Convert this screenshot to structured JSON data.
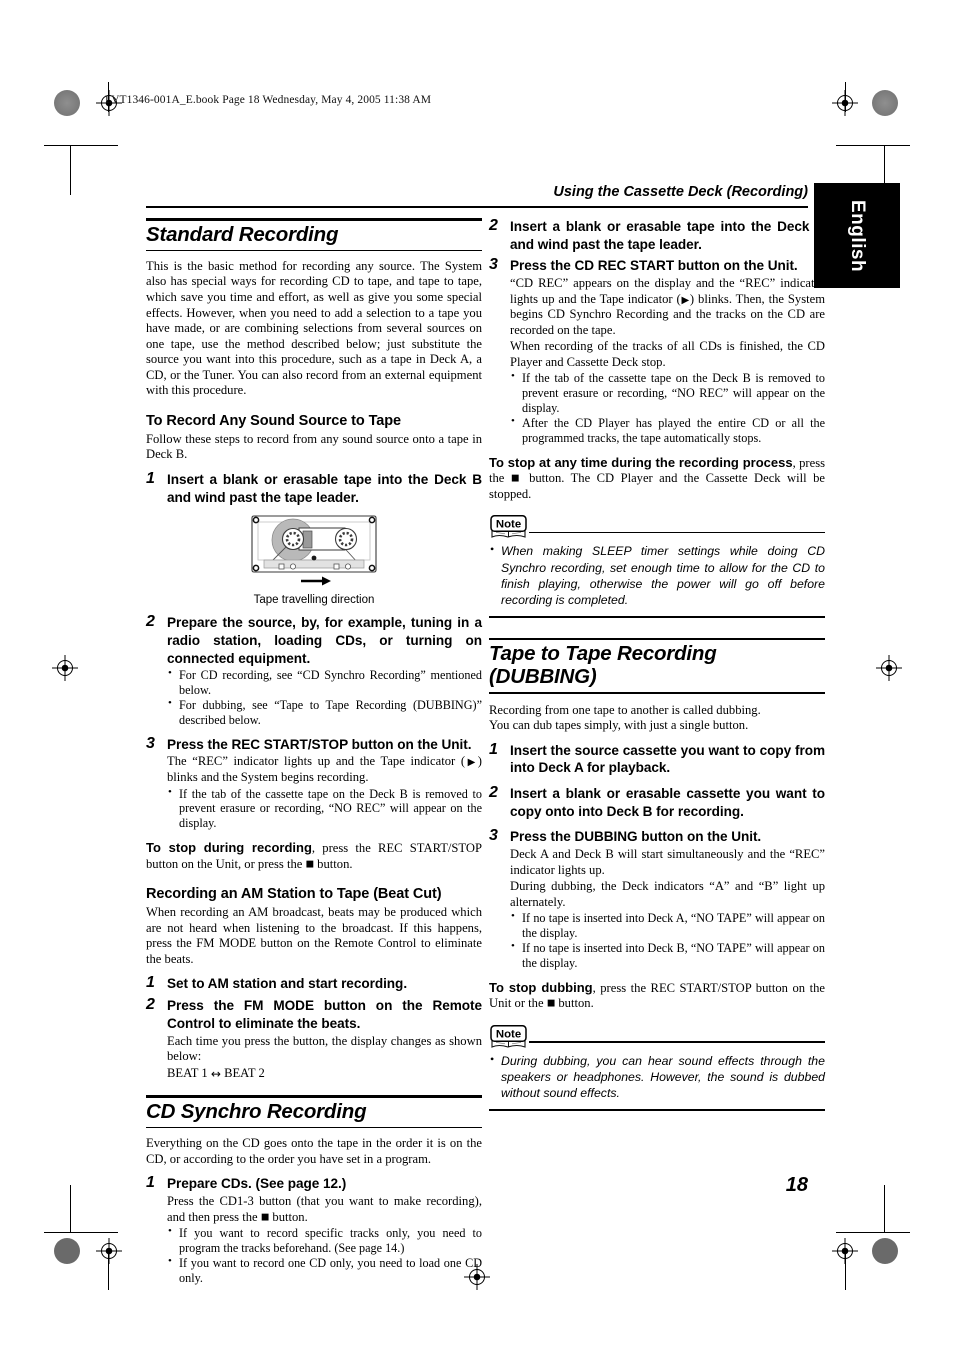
{
  "print_marks": {
    "file_header": "LVT1346-001A_E.book  Page 18  Wednesday, May 4, 2005  11:38 AM"
  },
  "running_head": "Using the Cassette Deck (Recording)",
  "side_tab": "English",
  "page_number": "18",
  "left_column": {
    "section1": {
      "title": "Standard Recording",
      "intro": "This is the basic method for recording any source. The System also has special ways for recording CD to tape, and tape to tape, which save you time and effort, as well as give you some special effects. However, when you need to add a selection to a tape you have made, or are combining selections from several sources on one tape, use the method described below; just substitute the source you want into this procedure, such as a tape in Deck A, a CD, or the Tuner. You can also record from an external equipment with this procedure.",
      "subtitle": "To Record Any Sound Source to Tape",
      "sub_intro": "Follow these steps to record from any sound source onto a tape in Deck B.",
      "steps": [
        {
          "num": "1",
          "title": "Insert a blank or erasable tape into the Deck B and wind past the tape leader."
        },
        {
          "num": "2",
          "title": "Prepare the source, by, for example, tuning in a radio station, loading CDs, or turning on connected equipment.",
          "bullets": [
            "For CD recording, see “CD Synchro Recording” mentioned below.",
            "For dubbing, see “Tape to Tape Recording (DUBBING)” described below."
          ]
        },
        {
          "num": "3",
          "title": "Press the REC START/STOP button on the Unit.",
          "body_pre": "The “REC” indicator lights up and the Tape indicator (",
          "body_post": ") blinks and the System begins recording.",
          "bullets": [
            "If the tab of the cassette tape on the Deck B is removed to prevent erasure or recording, “NO REC” will appear on the display."
          ]
        }
      ],
      "figure_caption": "Tape travelling direction",
      "stop_bold": "To stop during recording",
      "stop_pre": ", press the REC START/STOP button on the Unit, or press the ",
      "stop_post": " button."
    },
    "section2": {
      "subtitle": "Recording an AM Station to Tape (Beat Cut)",
      "intro": "When recording an AM broadcast, beats may be produced which are not heard when listening to the broadcast. If this happens, press the FM MODE button on the Remote Control to eliminate the beats.",
      "steps": [
        {
          "num": "1",
          "title": "Set to AM station and start recording."
        },
        {
          "num": "2",
          "title": "Press the FM MODE button on the Remote Control to eliminate the beats.",
          "body": "Each time you press the button, the display changes as shown below:",
          "beat_left": "BEAT 1",
          "beat_arrow": "↔",
          "beat_right": "BEAT 2"
        }
      ]
    },
    "section3": {
      "title": "CD Synchro Recording",
      "intro": "Everything on the CD goes onto the tape in the order it is on the CD, or according to the order you have set in a program.",
      "steps": [
        {
          "num": "1",
          "title": "Prepare CDs. (See page 12.)",
          "body_pre": "Press the CD1-3 button (that you want to make recording), and then press the ",
          "body_post": " button.",
          "bullets": [
            "If you want to record specific tracks only, you need to program the tracks beforehand. (See page 14.)",
            "If you want to record one CD only, you need to load one CD only."
          ]
        }
      ]
    }
  },
  "right_column": {
    "continued_steps": [
      {
        "num": "2",
        "title": "Insert a blank or erasable tape into the Deck B and wind past the tape leader."
      },
      {
        "num": "3",
        "title": "Press the CD REC START button on the Unit.",
        "body_pre": "“CD REC” appears on the display and the “REC” indicator lights up and the Tape indicator (",
        "body_post": ") blinks. Then, the System begins CD Synchro Recording and the tracks on the CD are recorded on the tape.",
        "body2": "When recording of the tracks of all CDs is finished, the CD Player and Cassette Deck stop.",
        "bullets": [
          "If the tab of the cassette tape on the Deck B is removed to prevent erasure or recording, “NO REC” will appear on the display.",
          "After the CD Player has played the entire CD or all the programmed tracks, the tape automatically stops."
        ]
      }
    ],
    "stop_any_bold": "To stop at any time during the recording process",
    "stop_any_pre": ", press the ",
    "stop_any_post": " button. The CD Player and the Cassette Deck will be stopped.",
    "note1": {
      "label": "Note",
      "items": [
        "When making SLEEP timer settings while doing CD Synchro recording, set enough time to allow for the CD to finish playing, otherwise the power will go off before recording is completed."
      ]
    },
    "section4": {
      "title": "Tape to Tape Recording (DUBBING)",
      "intro_line1": "Recording from one tape to another is called dubbing.",
      "intro_line2": "You can dub tapes simply, with just a single button.",
      "steps": [
        {
          "num": "1",
          "title": "Insert the source cassette you want to copy from into Deck A for playback."
        },
        {
          "num": "2",
          "title": "Insert a blank or erasable cassette you want to copy onto into Deck B for recording."
        },
        {
          "num": "3",
          "title": "Press the DUBBING button on the Unit.",
          "body": "Deck A and Deck B will start simultaneously and the “REC” indicator lights up.",
          "body2": "During dubbing, the Deck indicators “A” and “B” light up alternately.",
          "bullets": [
            "If no tape is inserted into Deck A, “NO TAPE” will appear on the display.",
            "If no tape is inserted into Deck B, “NO TAPE” will appear on the display."
          ]
        }
      ],
      "stop_bold": "To stop dubbing",
      "stop_pre": ", press the REC START/STOP button on the Unit or the ",
      "stop_post": " button."
    },
    "note2": {
      "label": "Note",
      "items": [
        "During dubbing, you can hear sound effects through the speakers or headphones. However, the sound is dubbed without sound effects."
      ]
    }
  }
}
